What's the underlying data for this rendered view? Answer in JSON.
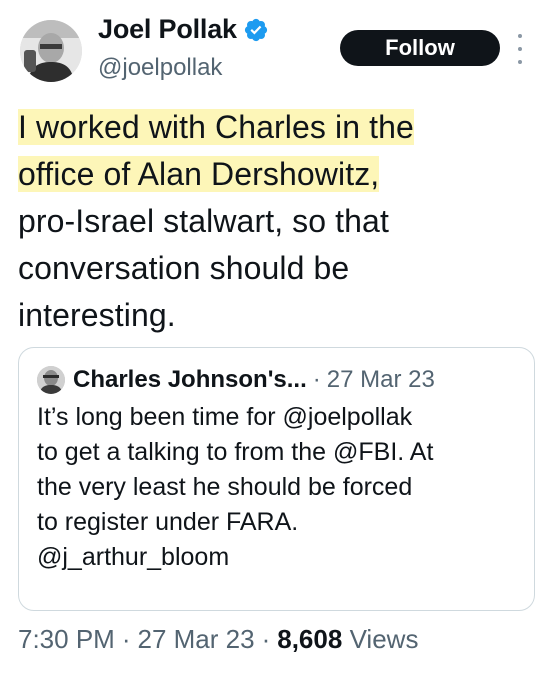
{
  "author": {
    "name": "Joel Pollak",
    "handle": "@joelpollak",
    "avatar_icon": "profile-photo-icon",
    "verified_icon": "verified-badge-icon",
    "verified_color": "#1d9bf0"
  },
  "follow_button": {
    "label": "Follow"
  },
  "more_menu": {
    "icon": "more-vertical-icon"
  },
  "tweet": {
    "highlight_color": "#fdf6b8",
    "lines": [
      "I worked with Charles in the",
      "office of Alan Dershowitz,",
      "pro-Israel stalwart, so that",
      "conversation should be",
      "interesting."
    ]
  },
  "quoted_tweet": {
    "author": "Charles Johnson's...",
    "separator": "·",
    "date": "27 Mar 23",
    "avatar_icon": "profile-photo-icon",
    "lines": [
      "It’s long been time for @joelpollak",
      "to get a talking to from the @FBI. At",
      "the very least he should be forced",
      "to register under FARA.",
      "@j_arthur_bloom"
    ]
  },
  "meta": {
    "time": "7:30 PM",
    "separator": "·",
    "date": "27 Mar 23",
    "views_count": "8,608",
    "views_label": "Views"
  },
  "colors": {
    "text_primary": "#0f1419",
    "text_secondary": "#536471",
    "border": "#cfd9de",
    "button_bg": "#0f1419"
  }
}
